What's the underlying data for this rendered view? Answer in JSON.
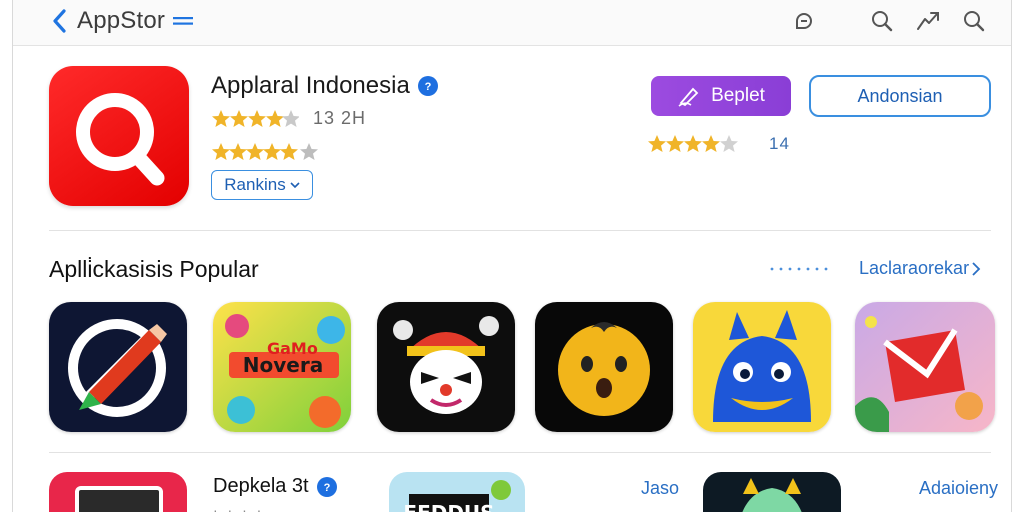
{
  "topbar": {
    "back_label": "AppStor",
    "icons": [
      "profile-icon",
      "search-icon",
      "share-icon",
      "search-icon"
    ]
  },
  "hero": {
    "app_name": "Applaral Indonesia",
    "rating_1": "13 2H",
    "rankings_label": "Rankins",
    "primary_button": "Beplet",
    "secondary_button": "Andonsian",
    "side_rating": "14",
    "colors": {
      "icon_bg": "#ff1a1a",
      "primary": "#9443de",
      "accent": "#3a8fe0"
    }
  },
  "section": {
    "title": "Aplli̇ckasisis Popular",
    "see_all": "Laclaraorekar",
    "apps": [
      {
        "icon": "pencil-app-icon"
      },
      {
        "icon": "colorful-game-icon"
      },
      {
        "icon": "clown-game-icon"
      },
      {
        "icon": "emoji-face-icon"
      },
      {
        "icon": "blue-monster-icon"
      },
      {
        "icon": "mail-app-icon"
      }
    ]
  },
  "row2": {
    "title": "Depkela 3t",
    "sub": "· · · ·",
    "link1": "Jaso",
    "link2": "Adaioieny",
    "tile_text": "FEDDUS"
  }
}
